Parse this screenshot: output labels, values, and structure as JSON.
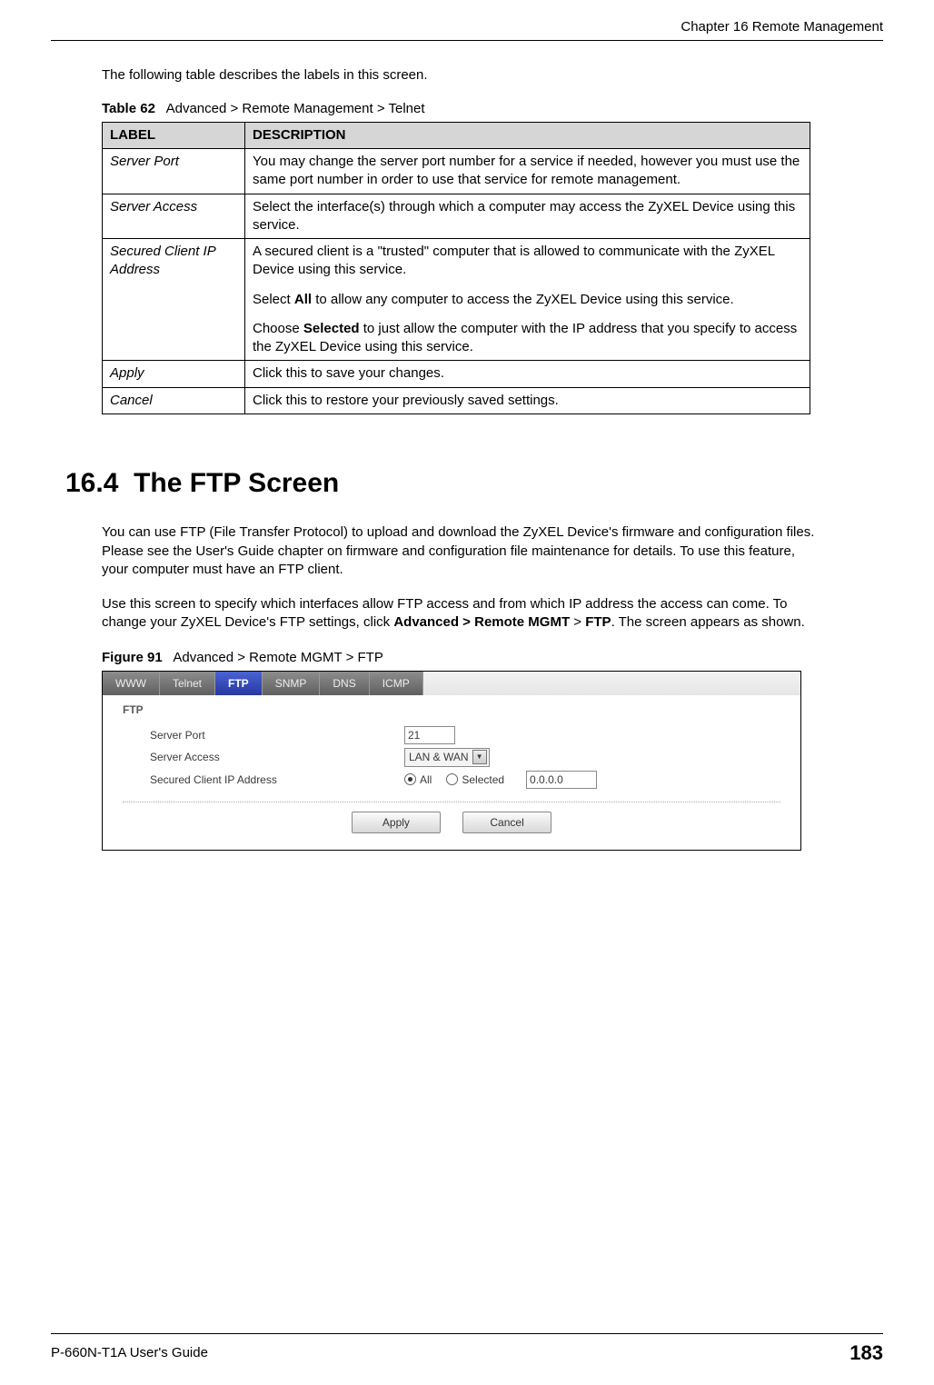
{
  "header": {
    "chapter": "Chapter 16 Remote Management"
  },
  "intro": "The following table describes the labels in this screen.",
  "table_caption": {
    "label": "Table 62",
    "text": "Advanced > Remote Management > Telnet"
  },
  "table_headers": {
    "label": "LABEL",
    "desc": "DESCRIPTION"
  },
  "rows": [
    {
      "label": "Server Port",
      "desc": "You may change the server port number for a service if needed, however you must use the same port number in order to use that service for remote management."
    },
    {
      "label": "Server Access",
      "desc": "Select the interface(s) through which a computer may access the ZyXEL Device using this service."
    },
    {
      "label": "Secured Client IP Address",
      "p1": "A secured client is a \"trusted\" computer that is allowed to communicate with the ZyXEL Device using this service.",
      "p2a": "Select ",
      "p2b": "All",
      "p2c": " to allow any computer to access the ZyXEL Device using this service.",
      "p3a": "Choose ",
      "p3b": "Selected",
      "p3c": " to just allow the computer with the IP address that you specify to access the ZyXEL Device using this service."
    },
    {
      "label": "Apply",
      "desc": "Click this to save your changes."
    },
    {
      "label": "Cancel",
      "desc": "Click this to restore your previously saved settings."
    }
  ],
  "section": {
    "number": "16.4",
    "title": "The FTP Screen"
  },
  "para1": "You can use FTP (File Transfer Protocol) to upload and download the ZyXEL Device's firmware and configuration files. Please see the User's Guide chapter on firmware and configuration file maintenance for details. To use this feature, your computer must have an FTP client.",
  "para2a": "Use this screen to specify which interfaces allow FTP access and from which IP address the access can come. To change your ZyXEL Device's FTP settings, click ",
  "para2b": "Advanced > Remote MGMT",
  "para2c": " > ",
  "para2d": "FTP",
  "para2e": ". The screen appears as shown.",
  "figure_caption": {
    "label": "Figure 91",
    "text": "Advanced > Remote MGMT > FTP"
  },
  "figure": {
    "tabs": [
      "WWW",
      "Telnet",
      "FTP",
      "SNMP",
      "DNS",
      "ICMP"
    ],
    "active_tab_index": 2,
    "panel_title": "FTP",
    "server_port_label": "Server Port",
    "server_port_value": "21",
    "server_access_label": "Server Access",
    "server_access_value": "LAN & WAN",
    "secured_label": "Secured Client IP Address",
    "radio_all": "All",
    "radio_selected": "Selected",
    "ip_value": "0.0.0.0",
    "apply": "Apply",
    "cancel": "Cancel"
  },
  "footer": {
    "guide": "P-660N-T1A User's Guide",
    "page": "183"
  }
}
